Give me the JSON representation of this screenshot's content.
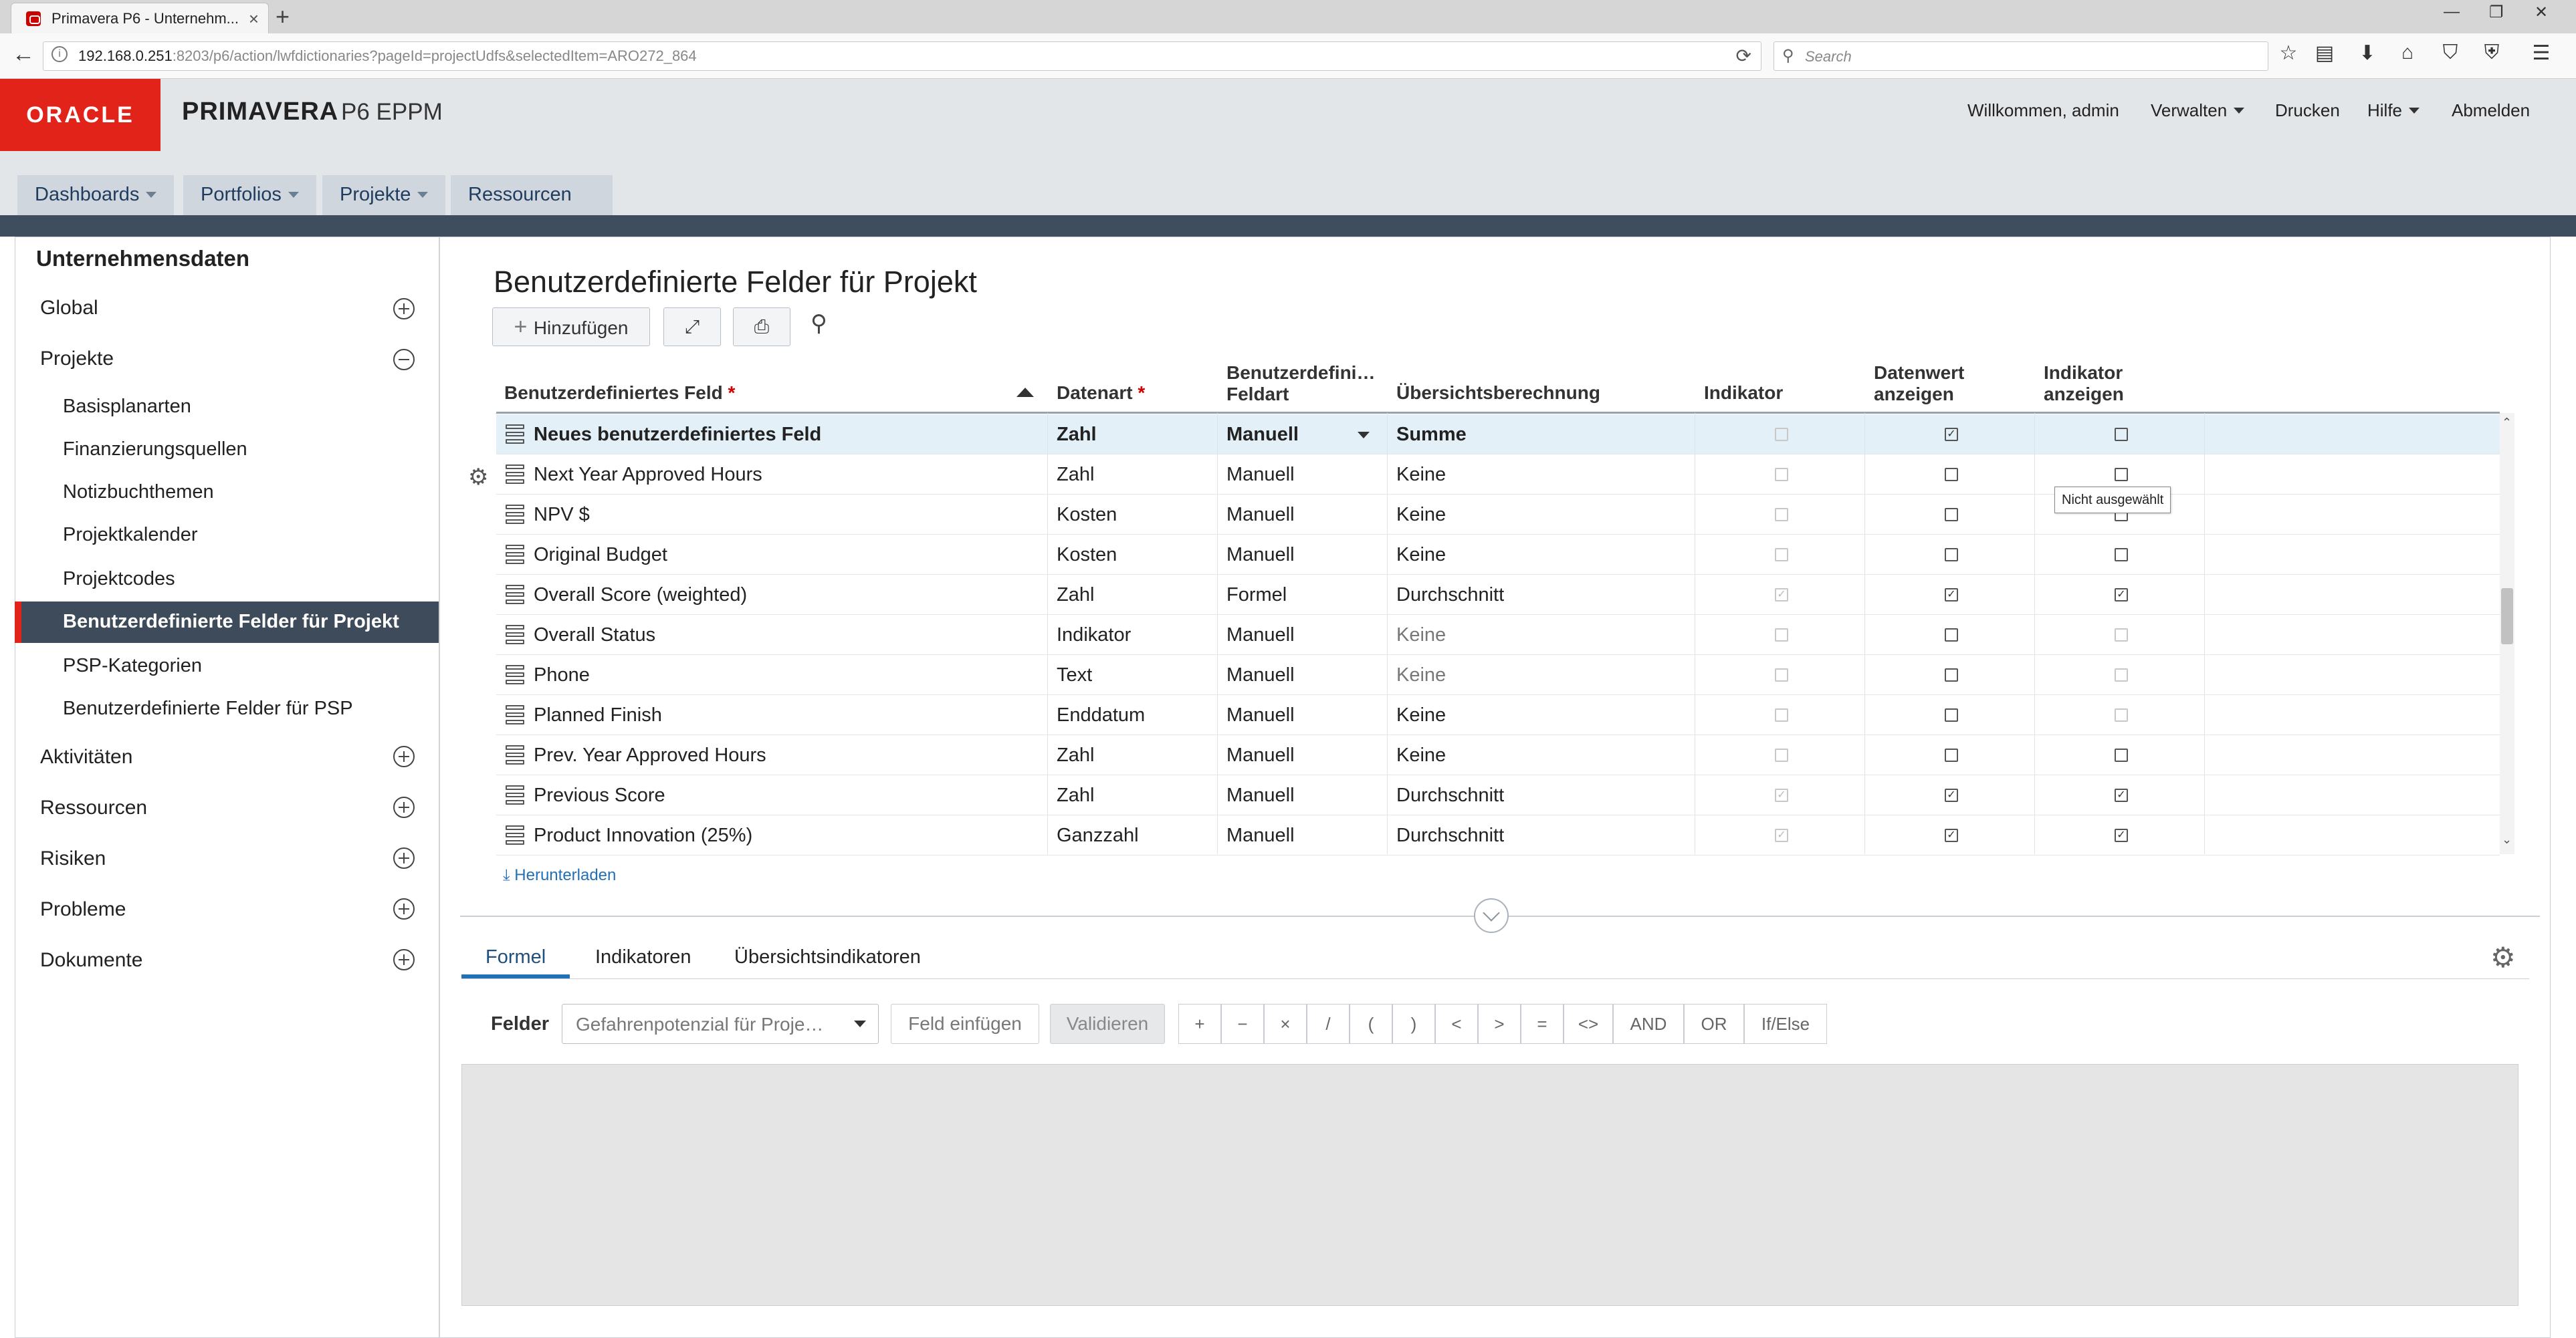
{
  "browser": {
    "tab_title": "Primavera P6 - Unternehm...",
    "tab_close": "×",
    "new_tab": "+",
    "url_host": "192.168.0.251",
    "url_rest": ":8203/p6/action/lwfdictionaries?pageId=projectUdfs&selectedItem=ARO272_864",
    "search_placeholder": "Search"
  },
  "app": {
    "brand": "ORACLE",
    "product": "PRIMAVERA",
    "edition": "P6 EPPM",
    "header_links": {
      "welcome": "Willkommen, admin",
      "manage": "Verwalten",
      "print": "Drucken",
      "help": "Hilfe",
      "logout": "Abmelden"
    },
    "main_tabs": [
      "Dashboards",
      "Portfolios",
      "Projekte",
      "Ressourcen"
    ]
  },
  "sidebar": {
    "title": "Unternehmensdaten",
    "top_items": [
      "Global",
      "Projekte",
      "Aktivitäten",
      "Ressourcen",
      "Risiken",
      "Probleme",
      "Dokumente"
    ],
    "sub_items": [
      "Basisplanarten",
      "Finanzierungsquellen",
      "Notizbuchthemen",
      "Projektkalender",
      "Projektcodes",
      "Benutzerdefinierte Felder für Projekt",
      "PSP-Kategorien",
      "Benutzerdefinierte Felder für PSP"
    ],
    "selected": "Benutzerdefinierte Felder für Projekt"
  },
  "page": {
    "title": "Benutzerdefinierte Felder für Projekt",
    "add_button": "Hinzufügen"
  },
  "grid": {
    "columns": {
      "field": "Benutzerdefiniertes Feld",
      "datatype": "Datenart",
      "fieldtype_1": "Benutzerdefini…",
      "fieldtype_2": "Feldart",
      "summary": "Übersichtsberechnung",
      "indicator": "Indikator",
      "showvalue_1": "Datenwert",
      "showvalue_2": "anzeigen",
      "showind_1": "Indikator",
      "showind_2": "anzeigen",
      "required_mark": "*"
    },
    "rows": [
      {
        "name": "Neues benutzerdefiniertes Feld",
        "datatype": "Zahl",
        "fieldtype": "Manuell",
        "summary": "Summe"
      },
      {
        "name": "Next Year Approved Hours",
        "datatype": "Zahl",
        "fieldtype": "Manuell",
        "summary": "Keine"
      },
      {
        "name": "NPV $",
        "datatype": "Kosten",
        "fieldtype": "Manuell",
        "summary": "Keine"
      },
      {
        "name": "Original Budget",
        "datatype": "Kosten",
        "fieldtype": "Manuell",
        "summary": "Keine"
      },
      {
        "name": "Overall Score (weighted)",
        "datatype": "Zahl",
        "fieldtype": "Formel",
        "summary": "Durchschnitt"
      },
      {
        "name": "Overall Status",
        "datatype": "Indikator",
        "fieldtype": "Manuell",
        "summary": "Keine"
      },
      {
        "name": "Phone",
        "datatype": "Text",
        "fieldtype": "Manuell",
        "summary": "Keine"
      },
      {
        "name": "Planned Finish",
        "datatype": "Enddatum",
        "fieldtype": "Manuell",
        "summary": "Keine"
      },
      {
        "name": "Prev. Year Approved Hours",
        "datatype": "Zahl",
        "fieldtype": "Manuell",
        "summary": "Keine"
      },
      {
        "name": "Previous Score",
        "datatype": "Zahl",
        "fieldtype": "Manuell",
        "summary": "Durchschnitt"
      },
      {
        "name": "Product Innovation (25%)",
        "datatype": "Ganzzahl",
        "fieldtype": "Manuell",
        "summary": "Durchschnitt"
      }
    ],
    "tooltip": "Nicht ausgewählt",
    "download_link": "Herunterladen"
  },
  "bottom": {
    "tabs": [
      "Formel",
      "Indikatoren",
      "Übersichtsindikatoren"
    ],
    "fields_label": "Felder",
    "fields_value": "Gefahrenpotenzial für Proje…",
    "insert_button": "Feld einfügen",
    "validate_button": "Validieren",
    "operators": [
      "+",
      "−",
      "×",
      "/",
      "(",
      ")",
      "<",
      ">",
      "=",
      "<>",
      "AND",
      "OR",
      "If/Else"
    ]
  }
}
